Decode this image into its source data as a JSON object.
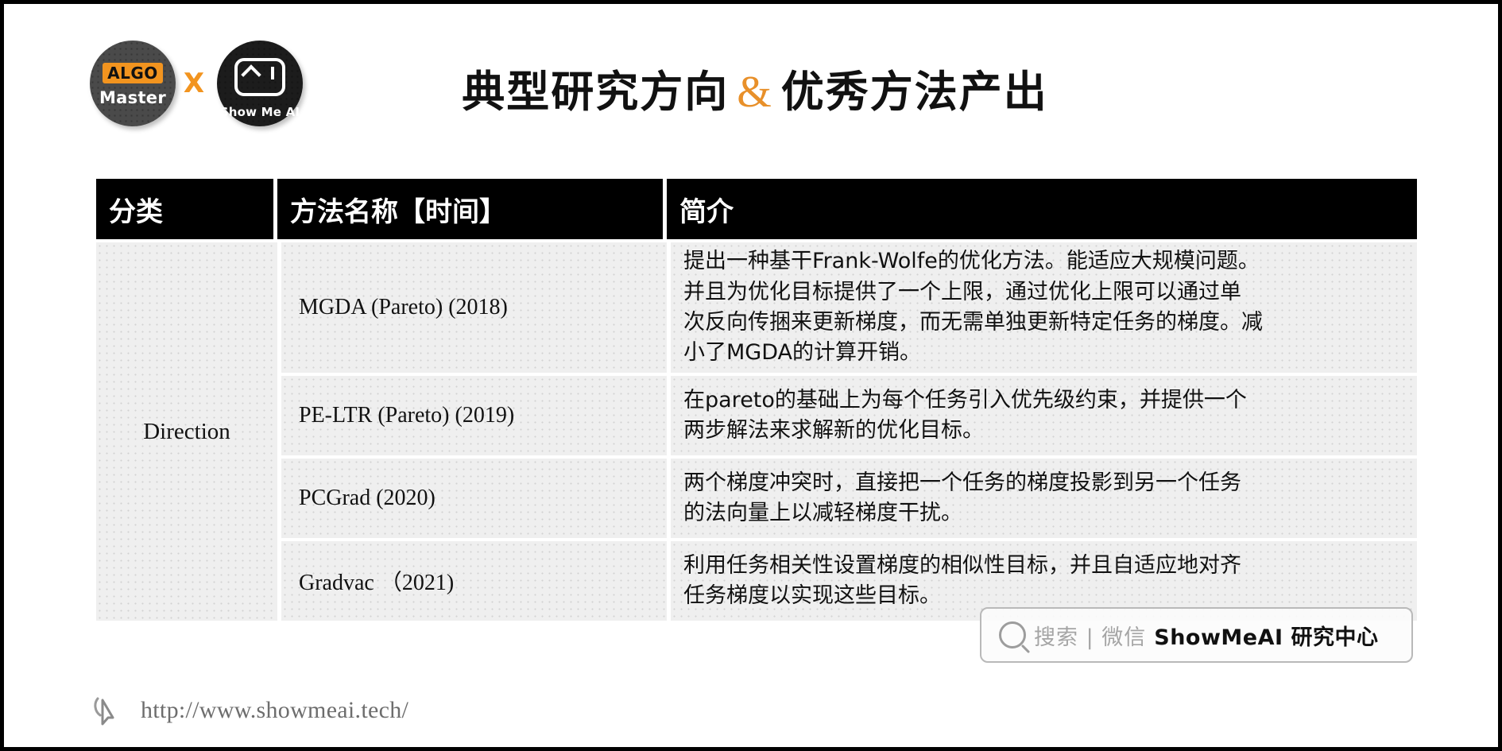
{
  "brand": {
    "logo_left_top": "ALGO",
    "logo_left_bottom": "Master",
    "logo_separator": "X",
    "logo_right_label": "Show Me AI"
  },
  "header": {
    "title_part1": "典型研究方向",
    "title_amp": "&",
    "title_part2": "优秀方法产出"
  },
  "table": {
    "columns": [
      "分类",
      "方法名称【时间】",
      "简介"
    ],
    "category": "Direction",
    "rows": [
      {
        "method": "MGDA (Pareto)  (2018)",
        "desc_lines": [
          "提出一种基干Frank-Wolfe的优化方法。能适应大规模问题。",
          "并且为优化目标提供了一个上限，通过优化上限可以通过单",
          "次反向传捆来更新梯度，而无需单独更新特定任务的梯度。减",
          "小了MGDA的计算开销。"
        ]
      },
      {
        "method": "PE-LTR (Pareto) (2019)",
        "desc_lines": [
          "在pareto的基础上为每个任务引入优先级约束，并提供一个",
          "两步解法来求解新的优化目标。"
        ]
      },
      {
        "method": "PCGrad  (2020)",
        "desc_lines": [
          "两个梯度冲突时，直接把一个任务的梯度投影到另一个任务",
          "的法向量上以减轻梯度干扰。"
        ]
      },
      {
        "method": "Gradvac （2021)",
        "desc_lines": [
          "利用任务相关性设置梯度的相似性目标，并且自适应地对齐",
          "任务梯度以实现这些目标。"
        ]
      }
    ]
  },
  "search_watermark": {
    "icon": "search-icon",
    "placeholder": "搜索 | 微信",
    "account": "ShowMeAI 研究中心"
  },
  "footer": {
    "icon": "cursor-icon",
    "url": "http://www.showmeai.tech/"
  },
  "colors": {
    "accent_orange": "#e8902a",
    "header_bg": "#000000",
    "cell_bg": "#efefef"
  }
}
